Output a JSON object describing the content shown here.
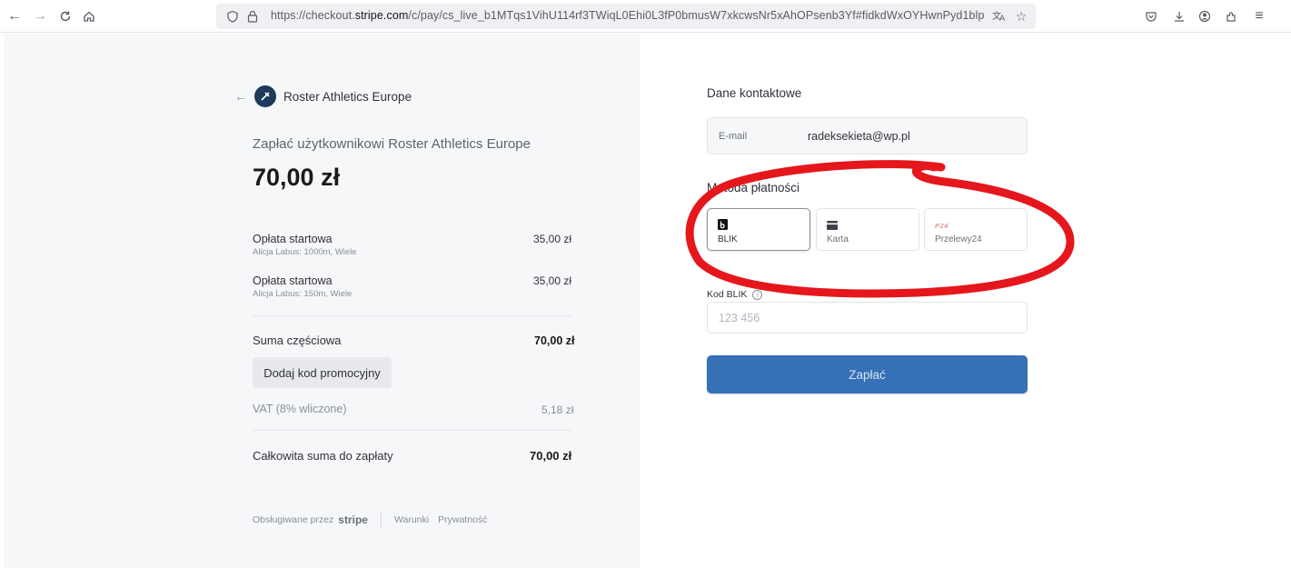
{
  "browser": {
    "url_prefix": "https://checkout.",
    "url_host": "stripe.com",
    "url_rest": "/c/pay/cs_live_b1MTqs1VihU114rf3TWiqL0Ehi0L3fP0bmusW7xkcwsNr5xAhOPsenb3Yf#fidkdWxOYHwnPyd1blpp"
  },
  "merchant": {
    "name": "Roster Athletics Europe",
    "pay_to": "Zapłać użytkownikowi Roster Athletics Europe",
    "amount": "70,00 zł"
  },
  "line_items": [
    {
      "title": "Opłata startowa",
      "subtitle": "Alicja Labus: 1000m, Wiele",
      "price": "35,00 zł"
    },
    {
      "title": "Opłata startowa",
      "subtitle": "Alicja Labus: 150m, Wiele",
      "price": "35,00 zł"
    }
  ],
  "summary": {
    "subtotal_label": "Suma częściowa",
    "subtotal_value": "70,00 zł",
    "promo_label": "Dodaj kod promocyjny",
    "vat_label": "VAT (8% wliczone)",
    "vat_value": "5,18 zł",
    "total_label": "Całkowita suma do zapłaty",
    "total_value": "70,00 zł"
  },
  "footer": {
    "powered_by": "Obsługiwane przez",
    "stripe": "stripe",
    "terms": "Warunki",
    "privacy": "Prywatność"
  },
  "contact": {
    "title": "Dane kontaktowe",
    "email_label": "E-mail",
    "email_value": "radeksekieta@wp.pl"
  },
  "payment": {
    "title": "Metoda płatności",
    "methods": [
      {
        "label": "BLIK",
        "icon": "blik-icon",
        "selected": true
      },
      {
        "label": "Karta",
        "icon": "card-icon",
        "selected": false
      },
      {
        "label": "Przelewy24",
        "icon": "przelewy24-icon",
        "selected": false
      }
    ],
    "blik_label": "Kod BLIK",
    "blik_placeholder": "123 456",
    "pay_label": "Zapłać"
  },
  "colors": {
    "pay_button": "#3671b7",
    "annotation": "#e5171c",
    "left_panel": "#f6f7f9"
  }
}
